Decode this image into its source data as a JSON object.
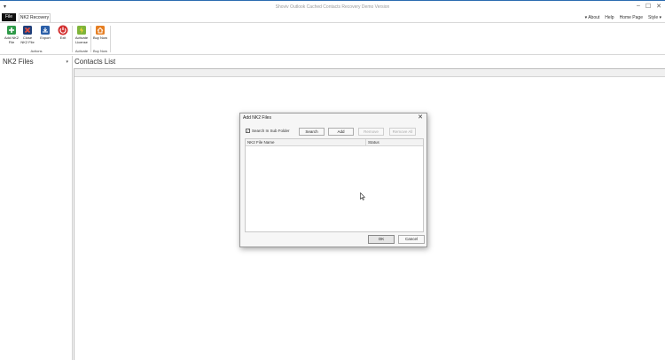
{
  "window": {
    "title": "Shoviv Outlook Cached Contacts Recovery Demo Version",
    "sysmenu_glyph": "▾",
    "controls": {
      "minimize": "–",
      "maximize": "☐",
      "close": "✕"
    }
  },
  "tabs": {
    "file": "File",
    "nk2": "NK2 Recovery"
  },
  "help_links": [
    "▾ About",
    "Help",
    "Home Page",
    "Style ▾"
  ],
  "ribbon": {
    "buttons": [
      {
        "label": "Add NK2 File",
        "icon": "add-file-icon",
        "color": "#2e9a48"
      },
      {
        "label": "Close NK2 File",
        "icon": "close-file-icon",
        "color": "#c0392b"
      },
      {
        "label": "Export",
        "icon": "export-icon",
        "color": "#2b5fa8"
      },
      {
        "label": "Exit",
        "icon": "power-icon",
        "color": "#d32f2f"
      },
      {
        "label": "Activate License",
        "icon": "license-icon",
        "color": "#7fb53a"
      },
      {
        "label": "Buy Now",
        "icon": "buy-icon",
        "color": "#e67e22"
      }
    ],
    "groups": {
      "actions": "Actions",
      "activate": "Activate",
      "buy_now": "Buy Now"
    }
  },
  "left_panel": {
    "title": "NK2 Files",
    "pin_glyph": "▾"
  },
  "main": {
    "title": "Contacts List"
  },
  "dialog": {
    "title": "Add NK2 Files",
    "close_glyph": "✕",
    "search_sub_folder": {
      "label": "Search In Sub Folder",
      "checked": true,
      "check_glyph": "✓"
    },
    "buttons": {
      "search": "Search",
      "add": "Add",
      "remove": "Remove",
      "remove_all": "Remove All"
    },
    "columns": {
      "file_name": "NK2 File Name",
      "status": "Status"
    },
    "ok": "OK",
    "cancel": "Cancel"
  }
}
